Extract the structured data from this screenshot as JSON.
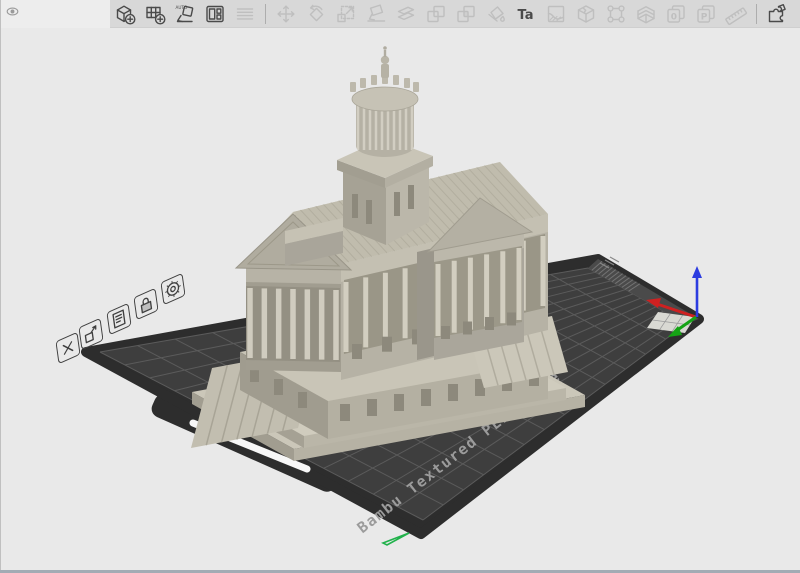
{
  "toolbar": {
    "colors": {
      "background": "#d8d8d8",
      "enabled": "#4a4a4a",
      "disabled": "#bfbfbf"
    },
    "items": [
      {
        "name": "add",
        "enabled": true
      },
      {
        "name": "add-plate",
        "enabled": true
      },
      {
        "name": "auto-orient",
        "enabled": true,
        "glyph": "AUTO"
      },
      {
        "name": "arrange",
        "enabled": true
      },
      {
        "name": "split-model",
        "enabled": false
      },
      {
        "name": "separator"
      },
      {
        "name": "move",
        "enabled": false
      },
      {
        "name": "rotate",
        "enabled": false
      },
      {
        "name": "scale",
        "enabled": false
      },
      {
        "name": "place-on-face",
        "enabled": false
      },
      {
        "name": "cut",
        "enabled": false
      },
      {
        "name": "split-to-objects",
        "enabled": false
      },
      {
        "name": "split-to-parts",
        "enabled": false
      },
      {
        "name": "color-painting",
        "enabled": false
      },
      {
        "name": "text",
        "enabled": true,
        "glyph": "Ta"
      },
      {
        "name": "support-painting",
        "enabled": false
      },
      {
        "name": "mesh-boolean",
        "enabled": false
      },
      {
        "name": "fix-model",
        "enabled": false
      },
      {
        "name": "variable-layer-height",
        "enabled": false
      },
      {
        "name": "stack-0",
        "enabled": false,
        "glyph": "0"
      },
      {
        "name": "stack-p",
        "enabled": false,
        "glyph": "P"
      },
      {
        "name": "measure",
        "enabled": false
      },
      {
        "name": "separator"
      },
      {
        "name": "assembly-view",
        "enabled": true
      }
    ]
  },
  "viewport": {
    "background": "#e9e9e9",
    "plate": {
      "label": "Bambu Textured PEI Plate",
      "colors": {
        "rim": "#2d2d2d",
        "surface": "#3e3e3e",
        "grid": "#5b5b5b",
        "band": "#4a4a4a",
        "hatch": "#747474",
        "corner_patch": "#d9d9d3",
        "patch_grid": "#9a9a9a",
        "slot": "#f7f7f7",
        "label": "#9b9b9b"
      },
      "edge_icons": [
        {
          "name": "delete-plate"
        },
        {
          "name": "arrange-plate"
        },
        {
          "name": "plate-name"
        },
        {
          "name": "lock-plate"
        },
        {
          "name": "plate-settings"
        }
      ]
    },
    "axes": {
      "x": "#cf2121",
      "y": "#15a315",
      "z": "#2c3ce0"
    },
    "model": {
      "description": "capitol building 3d model",
      "colors": {
        "light": "#d3cfc1",
        "mid": "#c1bdaf",
        "shade": "#a19d90",
        "roof": "#cbc7b8",
        "roof_shade": "#c0bcad",
        "stripe": "#b7b3a4",
        "column": "#d2cec0",
        "colonnade_bg": "#9a9687",
        "window": "#8d897c"
      }
    },
    "origin_marker_color": "#21b24b"
  }
}
